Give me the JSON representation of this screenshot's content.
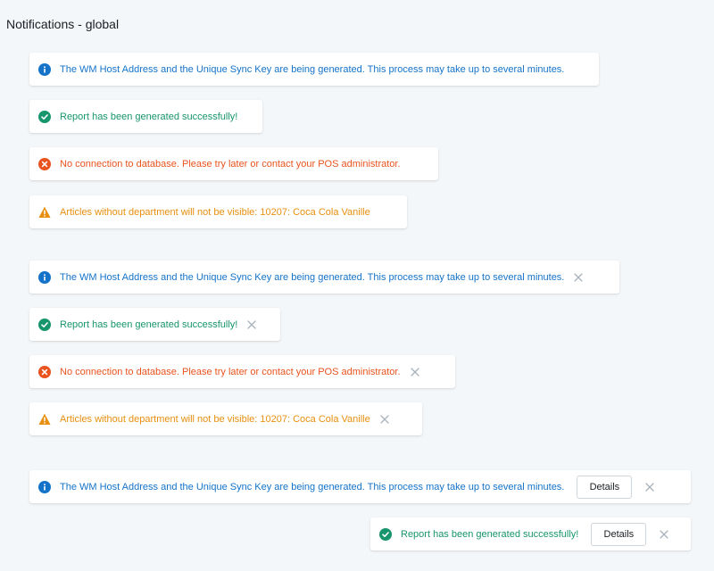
{
  "page_title": "Notifications - global",
  "messages": {
    "info": "The WM Host Address and the Unique Sync Key are being generated. This process may take up to several minutes.",
    "success": "Report has been generated successfully!",
    "error": "No connection to database. Please try later or contact your POS administrator.",
    "warning": "Articles without department will not be visible: 10207: Coca Cola Vanille"
  },
  "details_label": "Details",
  "icons": {
    "info": "info-icon",
    "success": "check-circle-icon",
    "error": "x-circle-icon",
    "warning": "warning-triangle-icon",
    "close": "close-icon"
  },
  "colors": {
    "info": "#1473c9",
    "success": "#17956c",
    "error": "#e9531e",
    "warning": "#e88f0f",
    "background": "#f4f7f9"
  }
}
